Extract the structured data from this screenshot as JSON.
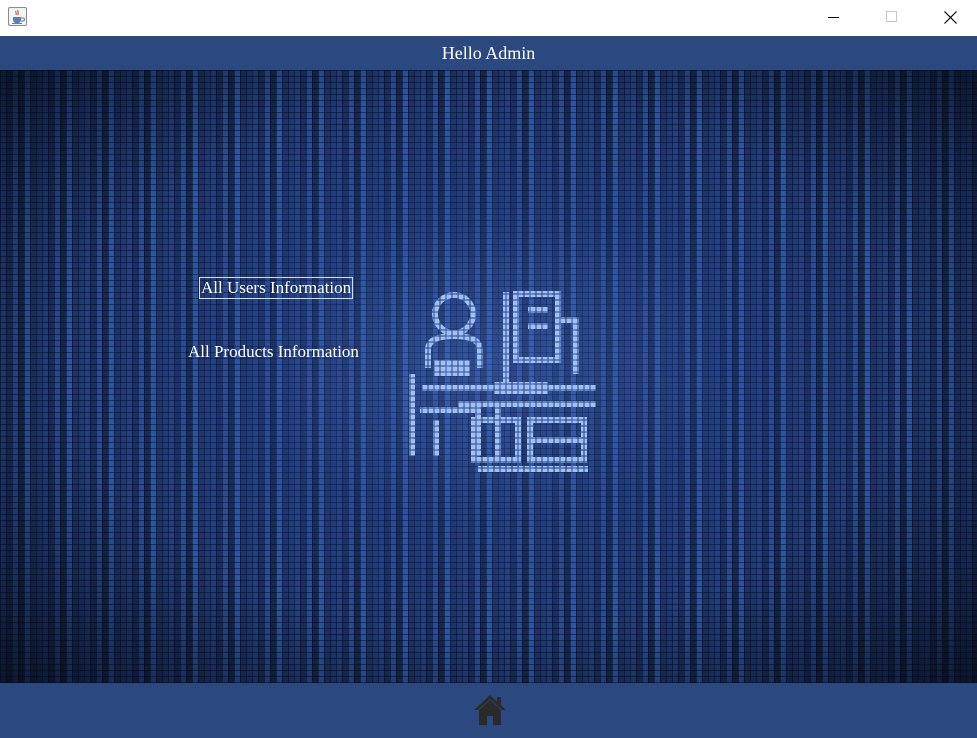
{
  "window": {
    "icons": {
      "app": "java-cup-icon",
      "minimize": "minimize-icon",
      "maximize": "maximize-icon",
      "close": "close-icon"
    }
  },
  "header": {
    "title": "Hello Admin",
    "background": "#2c497f"
  },
  "menu": {
    "users_label": "All Users Information",
    "products_label": "All Products Information"
  },
  "illustration": {
    "icon": "admin-desk-pixel-icon"
  },
  "footer": {
    "background": "#2c497f",
    "home_icon": "home-icon",
    "home_color": "#2a2a2a"
  },
  "colors": {
    "text": "#ffffff",
    "mosaic_base": "#1b2c5a",
    "mosaic_light": "#a9c6ff"
  }
}
